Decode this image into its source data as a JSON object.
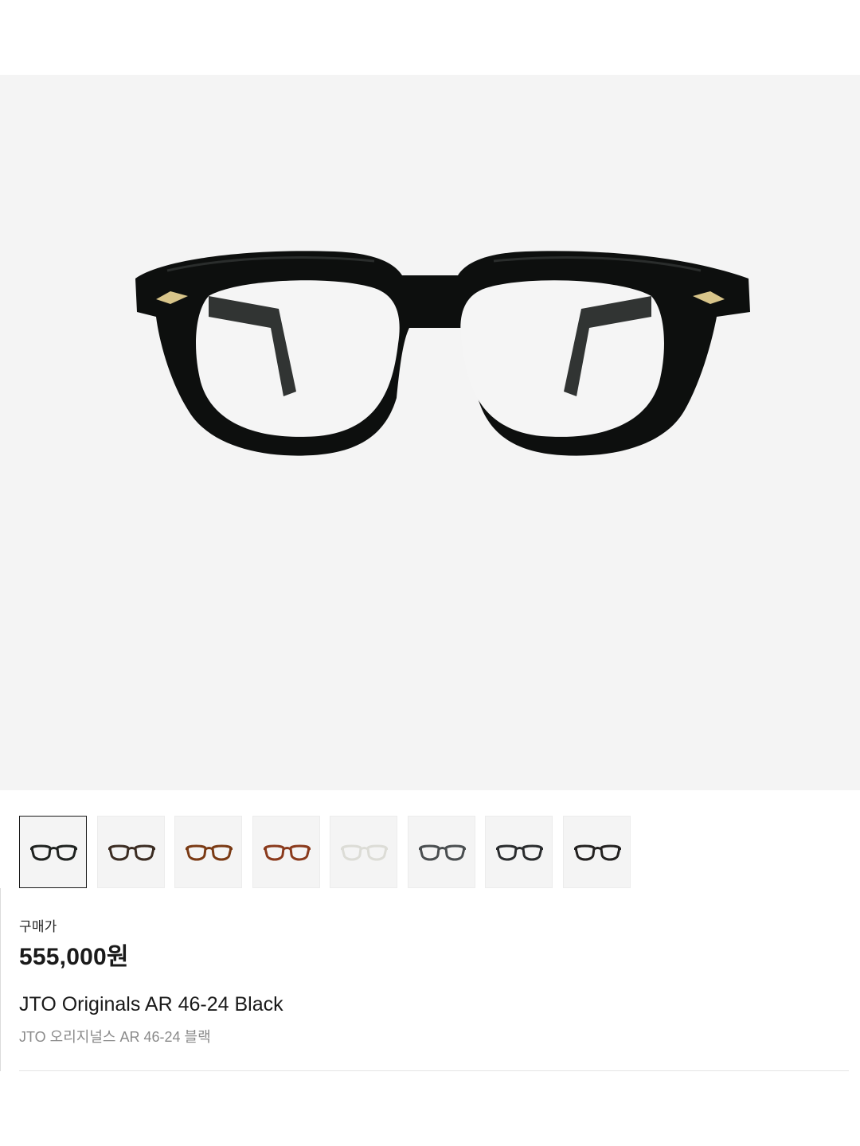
{
  "product": {
    "image_alt": "JTO Originals AR 46-24 Black",
    "price_label": "구매가",
    "price": "555,000원",
    "name_en": "JTO Originals AR 46-24 Black",
    "name_ko": "JTO 오리지널스 AR 46-24 블랙"
  },
  "colors": {
    "hero_bg": "#f4f4f4",
    "frame_black": "#0d0f0e",
    "rivet_gold": "#d8c58a"
  },
  "thumbnails": [
    {
      "name": "thumb-black",
      "frame": "#1f2220",
      "selected": true
    },
    {
      "name": "thumb-dark-tortoise",
      "frame": "#3b2c22",
      "selected": false
    },
    {
      "name": "thumb-tortoise",
      "frame": "#7a3a14",
      "selected": false
    },
    {
      "name": "thumb-amber",
      "frame": "#8a3a1c",
      "selected": false
    },
    {
      "name": "thumb-clear",
      "frame": "#dcdcd6",
      "selected": false
    },
    {
      "name": "thumb-grey",
      "frame": "#4a4e50",
      "selected": false
    },
    {
      "name": "thumb-charcoal",
      "frame": "#2a2c2e",
      "selected": false
    },
    {
      "name": "thumb-black-tortoise",
      "frame": "#232120",
      "selected": false
    }
  ]
}
